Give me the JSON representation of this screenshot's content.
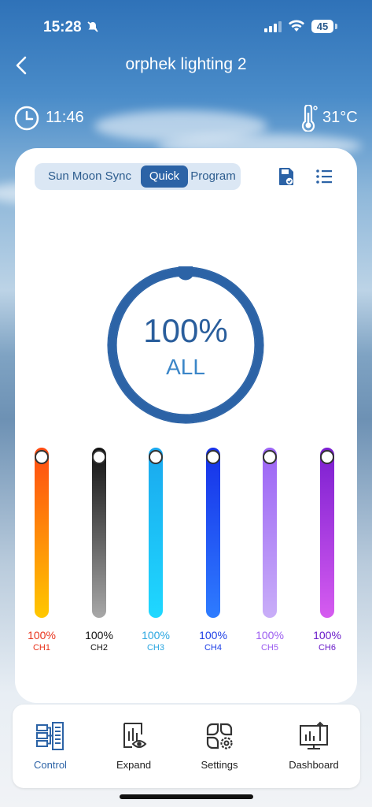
{
  "status_bar": {
    "time": "15:28",
    "battery": "45"
  },
  "header": {
    "title": "orphek lighting 2"
  },
  "info": {
    "time": "11:46",
    "temperature": "31°C"
  },
  "tabs": [
    {
      "label": "Sun Moon Sync",
      "active": false
    },
    {
      "label": "Quick",
      "active": true
    },
    {
      "label": "Program",
      "active": false
    }
  ],
  "dial": {
    "value": "100%",
    "label": "ALL",
    "level": 1.0
  },
  "channels": [
    {
      "percent": "100%",
      "name": "CH1",
      "level": 1.0,
      "color": "#e8331c",
      "gradient_top": "#ff4a12",
      "gradient_bottom": "#ffc800"
    },
    {
      "percent": "100%",
      "name": "CH2",
      "level": 1.0,
      "color": "#111111",
      "gradient_top": "#111111",
      "gradient_bottom": "#a8a8a8"
    },
    {
      "percent": "100%",
      "name": "CH3",
      "level": 1.0,
      "color": "#2aa6e0",
      "gradient_top": "#1aa8ee",
      "gradient_bottom": "#1fd8ff"
    },
    {
      "percent": "100%",
      "name": "CH4",
      "level": 1.0,
      "color": "#1d3fe6",
      "gradient_top": "#1630e8",
      "gradient_bottom": "#2e7cff"
    },
    {
      "percent": "100%",
      "name": "CH5",
      "level": 1.0,
      "color": "#9b5cf0",
      "gradient_top": "#9b63f5",
      "gradient_bottom": "#c9aef8"
    },
    {
      "percent": "100%",
      "name": "CH6",
      "level": 1.0,
      "color": "#6a1cc9",
      "gradient_top": "#7a1ed0",
      "gradient_bottom": "#d65cf0"
    }
  ],
  "nav": [
    {
      "label": "Control",
      "icon": "control-icon",
      "active": true
    },
    {
      "label": "Expand",
      "icon": "expand-icon",
      "active": false
    },
    {
      "label": "Settings",
      "icon": "settings-icon",
      "active": false
    },
    {
      "label": "Dashboard",
      "icon": "dashboard-icon",
      "active": false
    }
  ],
  "colors": {
    "accent": "#2c63a6",
    "nav_active": "#2c63a6"
  }
}
